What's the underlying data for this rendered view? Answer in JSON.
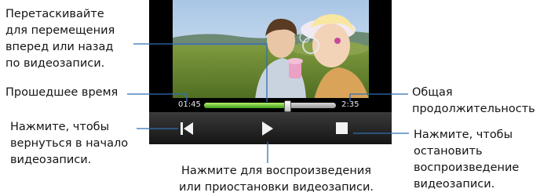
{
  "callouts": {
    "drag": "Перетаскивайте\nдля перемещения\nвперед или назад\nпо видеозаписи.",
    "elapsed": "Прошедшее время",
    "total": "Общая\nпродолжительность",
    "restart": "Нажмите, чтобы\nвернуться в начало\nвидеозаписи.",
    "stop": "Нажмите, чтобы\nостановить\nвоспроизведение\nвидеозаписи.",
    "play": "Нажмите для воспроизведения\nили приостановки видеозаписи."
  },
  "player": {
    "elapsed_time": "01:45",
    "total_time": "2:35",
    "progress_fraction": 0.63,
    "colors": {
      "progress_fill": "#4fb223",
      "track": "#bcbcbc",
      "controls_bar": "#262626"
    },
    "icons": {
      "restart": "skip-to-start-icon",
      "play": "play-icon",
      "stop": "stop-icon"
    }
  }
}
